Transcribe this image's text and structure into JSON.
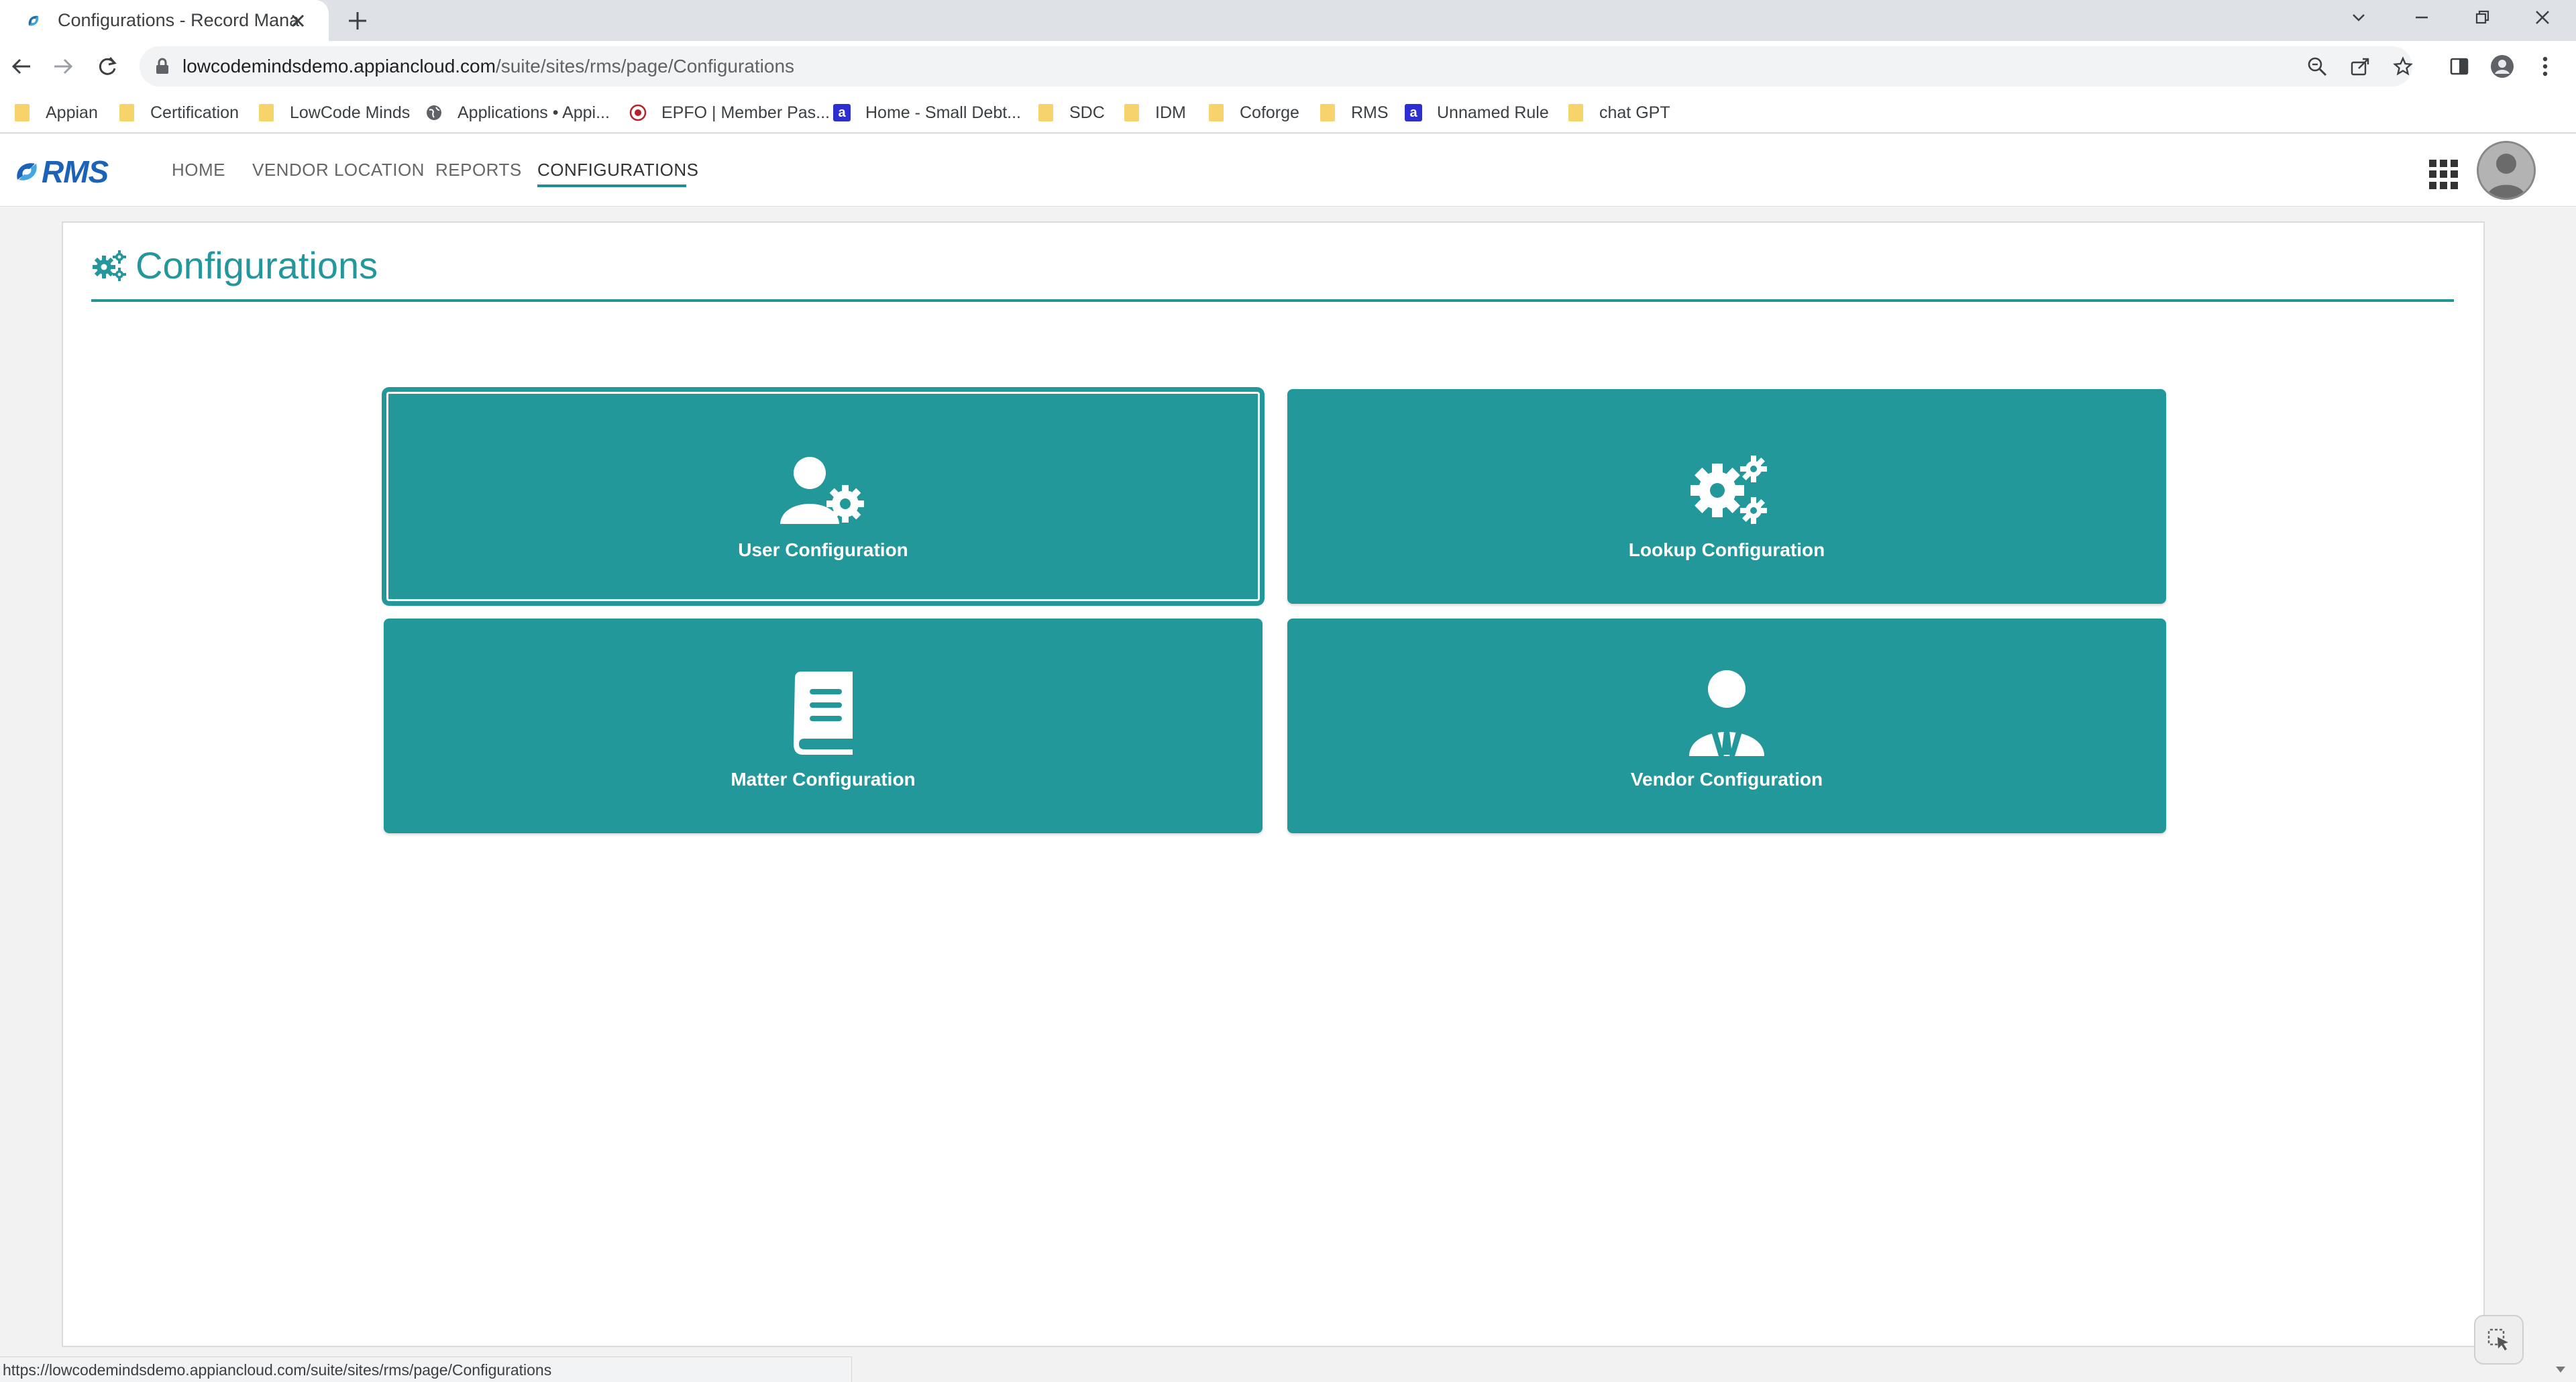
{
  "browser": {
    "tab_title": "Configurations - Record Manage",
    "url_host": "lowcodemindsdemo.appiancloud.com",
    "url_path": "/suite/sites/rms/page/Configurations",
    "bookmarks": [
      {
        "label": "Appian",
        "icon": "folder-icon"
      },
      {
        "label": "Certification",
        "icon": "folder-icon"
      },
      {
        "label": "LowCode Minds",
        "icon": "folder-icon"
      },
      {
        "label": "Applications • Appi...",
        "icon": "globe-icon"
      },
      {
        "label": "EPFO | Member Pas...",
        "icon": "emblem-icon"
      },
      {
        "label": "Home - Small Debt...",
        "icon": "a-square-icon"
      },
      {
        "label": "SDC",
        "icon": "folder-icon"
      },
      {
        "label": "IDM",
        "icon": "folder-icon"
      },
      {
        "label": "Coforge",
        "icon": "folder-icon"
      },
      {
        "label": "RMS",
        "icon": "folder-icon"
      },
      {
        "label": "Unnamed Rule",
        "icon": "a-square-icon"
      },
      {
        "label": "chat GPT",
        "icon": "folder-icon"
      }
    ],
    "status_url": "https://lowcodemindsdemo.appiancloud.com/suite/sites/rms/page/Configurations"
  },
  "app": {
    "logo_text": "RMS",
    "nav": [
      {
        "label": "HOME",
        "active": false
      },
      {
        "label": "VENDOR LOCATION",
        "active": false
      },
      {
        "label": "REPORTS",
        "active": false
      },
      {
        "label": "CONFIGURATIONS",
        "active": true
      }
    ]
  },
  "page": {
    "title": "Configurations",
    "tiles": [
      {
        "label": "User Configuration",
        "icon": "user-gear-icon"
      },
      {
        "label": "Lookup Configuration",
        "icon": "gears-icon"
      },
      {
        "label": "Matter Configuration",
        "icon": "book-icon"
      },
      {
        "label": "Vendor Configuration",
        "icon": "user-tie-icon"
      }
    ]
  },
  "colors": {
    "accent": "#23979b",
    "tile_bg": "#23989b",
    "nav_underline": "#1f8f94",
    "logo_blue": "#1c63b7"
  }
}
